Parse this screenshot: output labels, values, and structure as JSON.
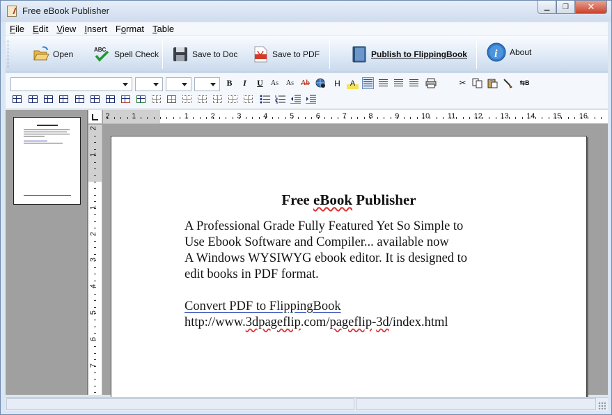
{
  "window": {
    "title": "Free eBook Publisher"
  },
  "menu": [
    "File",
    "Edit",
    "View",
    "Insert",
    "Format",
    "Table"
  ],
  "menu_mnemonics": [
    "F",
    "E",
    "V",
    "I",
    "o",
    "T"
  ],
  "toolbar": {
    "open": "Open",
    "spell_check": "Spell Check",
    "save_doc": "Save to Doc",
    "save_pdf": "Save to PDF",
    "publish": "Publish to FlippingBook",
    "about": "About"
  },
  "format": {
    "bold": "B",
    "italic": "I",
    "underline": "U",
    "heading": "H"
  },
  "ruler": {
    "h_labels": [
      "2",
      "1",
      "1",
      "2",
      "3",
      "4",
      "5",
      "6",
      "7",
      "8",
      "9",
      "10",
      "11",
      "12",
      "13",
      "14",
      "15",
      "16"
    ],
    "v_labels": [
      "2",
      "1",
      "1",
      "2",
      "3",
      "4",
      "5",
      "6",
      "7"
    ]
  },
  "document": {
    "title_prefix": "Free ",
    "title_sq": "eBook",
    "title_suffix": " Publisher",
    "lines": [
      "A Professional Grade Fully Featured Yet So Simple to",
      "Use Ebook Software and Compiler... available now",
      "A Windows WYSIWYG ebook editor. It is designed to",
      "edit books in PDF format."
    ],
    "link_text": "Convert PDF to FlippingBook",
    "url_parts": [
      "http://www.",
      "3dpageflip",
      ".com/",
      "pageflip",
      "-",
      "3d",
      "/index.html"
    ]
  },
  "colors": {
    "accent": "#1b3db0",
    "title_bar": "#cfdcee",
    "workspace": "#a0a0a0",
    "close_button": "#c7432c"
  }
}
